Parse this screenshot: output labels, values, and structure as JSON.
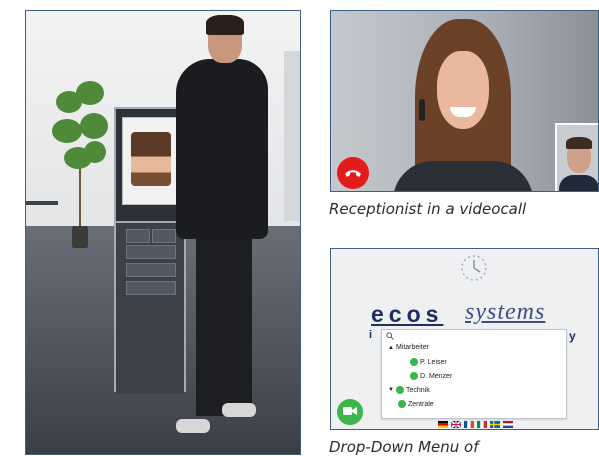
{
  "captions": {
    "videocall": "Receptionist in a videocall",
    "dropdown": "Drop-Down Menu of"
  },
  "logo": {
    "ecos": "ecos",
    "systems": "systems",
    "partial_left": "i",
    "partial_right": "y"
  },
  "dropdown": {
    "search_icon": "search-icon",
    "items": [
      {
        "label": "Mitarbeiter",
        "expander": "▲",
        "status": null
      },
      {
        "label": "P. Leiser",
        "expander": null,
        "status": "online"
      },
      {
        "label": "D. Menzer",
        "expander": null,
        "status": "online"
      },
      {
        "label": "Technik",
        "expander": "▼",
        "status": "online"
      },
      {
        "label": "Zentrale",
        "expander": null,
        "status": "online"
      }
    ]
  },
  "language_flags": [
    "de-flag",
    "uk-flag",
    "fr-flag",
    "it-flag",
    "se-flag",
    "nl-flag"
  ],
  "colors": {
    "hangup": "#e31b1b",
    "call": "#3eb54a",
    "status_online": "#39b54a",
    "logo_blue": "#1e2f61"
  }
}
